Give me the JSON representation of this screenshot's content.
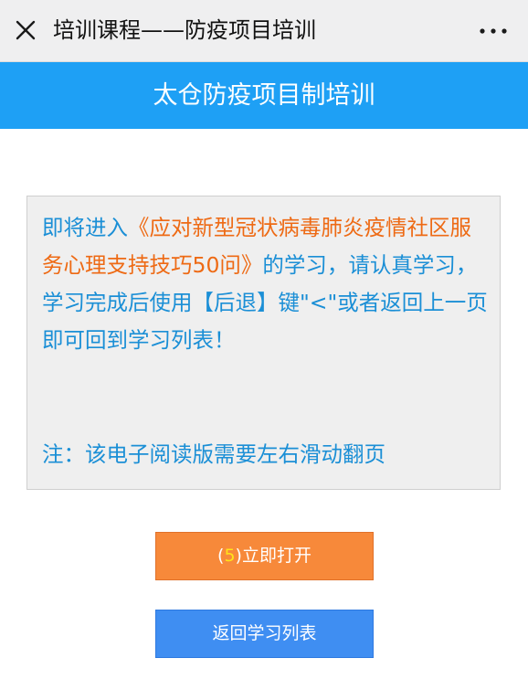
{
  "window": {
    "title": "培训课程——防疫项目培训",
    "close_icon": "close-icon",
    "more_icon": "more-dots-icon"
  },
  "banner": {
    "title": "太仓防疫项目制培训",
    "background": "#1ea0f5"
  },
  "notice": {
    "prefix": "即将进入",
    "course_title": "《应对新型冠状病毒肺炎疫情社区服务心理支持技巧50问》",
    "suffix": "的学习，请认真学习，学习完成后使用【后退】键\"<\"或者返回上一页即可回到学习列表！",
    "note": "注：该电子阅读版需要左右滑动翻页",
    "text_color": "#1b8fd6",
    "highlight_color": "#ee6a14"
  },
  "buttons": {
    "open": {
      "open_paren": "(",
      "countdown": "5",
      "close_paren": ")",
      "label": "立即打开",
      "color": "#f7893a"
    },
    "back": {
      "label": "返回学习列表",
      "color": "#3f8ef2"
    }
  }
}
